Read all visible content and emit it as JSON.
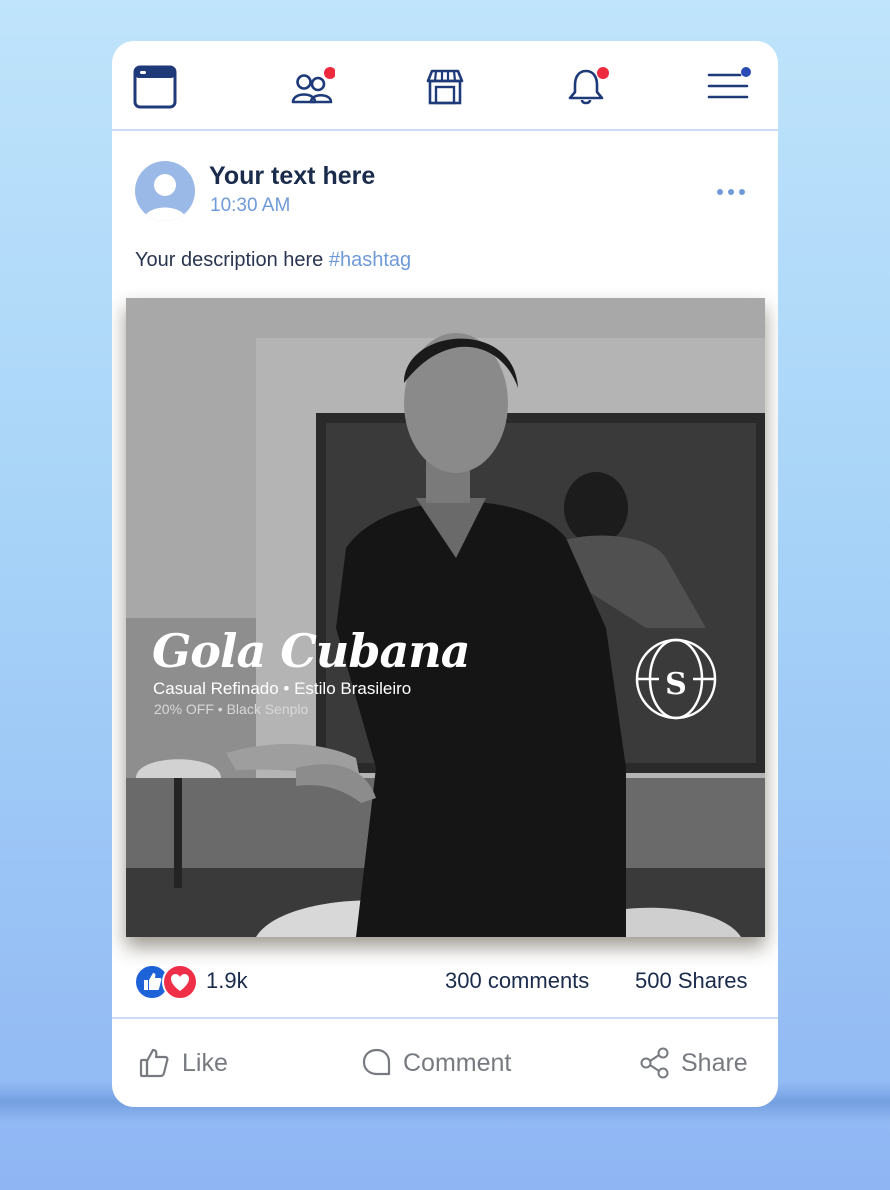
{
  "nav": {
    "items": [
      {
        "icon": "browser-window-icon",
        "badge": false
      },
      {
        "icon": "friends-icon",
        "badge": true
      },
      {
        "icon": "marketplace-store-icon",
        "badge": false
      },
      {
        "icon": "notifications-bell-icon",
        "badge": true
      },
      {
        "icon": "hamburger-menu-icon",
        "badge": true
      }
    ],
    "colors": {
      "icon": "#1f3a78",
      "badge_red": "#ee2a3f",
      "badge_blue": "#2a4bb5"
    }
  },
  "post": {
    "author": "Your text here",
    "time": "10:30 AM",
    "description": "Your description here",
    "hashtag": "#hashtag",
    "more_icon": "more-options-icon"
  },
  "image_ad": {
    "title": "Gola  Cubana",
    "subtitle": "Casual Refinado • Estilo Brasileiro",
    "offer": "20% OFF • Black Senplo",
    "logo_letter": "S"
  },
  "stats": {
    "likes": "1.9k",
    "comments": "300 comments",
    "shares": "500 Shares",
    "reaction_icons": [
      "like-reaction-icon",
      "love-reaction-icon"
    ]
  },
  "actions": {
    "like": "Like",
    "comment": "Comment",
    "share": "Share"
  },
  "colors": {
    "accent": "#6f9ad8",
    "text_dark": "#1a2b4c",
    "like_blue": "#1e62d8",
    "love_red": "#ef2f47"
  }
}
